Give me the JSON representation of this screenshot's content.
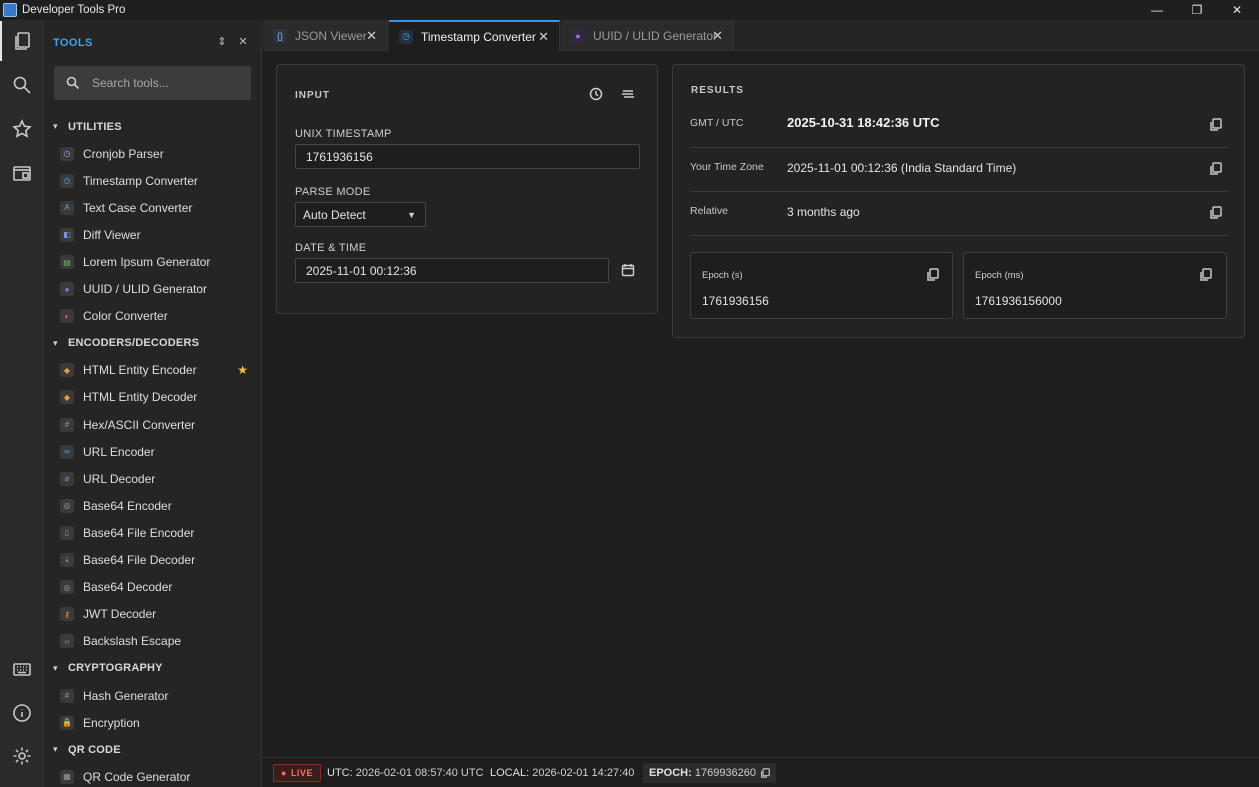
{
  "window": {
    "title": "Developer Tools Pro",
    "controls": [
      "—",
      "❐",
      "✕"
    ]
  },
  "activity": {
    "items": [
      "explorer",
      "search",
      "favorites",
      "window"
    ],
    "bottom": [
      "keyboard",
      "info",
      "settings"
    ]
  },
  "sidebar": {
    "header": "TOOLS",
    "search_placeholder": "Search tools...",
    "categories": [
      {
        "label": "UTILITIES",
        "tools": [
          {
            "label": "Cronjob Parser",
            "color": "#b48be0",
            "glyph": "◷"
          },
          {
            "label": "Timestamp Converter",
            "color": "#4aa3e0",
            "glyph": "◷"
          },
          {
            "label": "Text Case Converter",
            "color": "#6aa0d8",
            "glyph": "A"
          },
          {
            "label": "Diff Viewer",
            "color": "#7a9ae0",
            "glyph": "◧"
          },
          {
            "label": "Lorem Ipsum Generator",
            "color": "#5cb85c",
            "glyph": "▤"
          },
          {
            "label": "UUID / ULID Generator",
            "color": "#a070d0",
            "glyph": "●"
          },
          {
            "label": "Color Converter",
            "color": "#e06a8a",
            "glyph": "◐"
          }
        ]
      },
      {
        "label": "ENCODERS/DECODERS",
        "tools": [
          {
            "label": "HTML Entity Encoder",
            "color": "#e8a030",
            "glyph": "◆",
            "favorite": true
          },
          {
            "label": "HTML Entity Decoder",
            "color": "#e8a030",
            "glyph": "◆"
          },
          {
            "label": "Hex/ASCII Converter",
            "color": "#9a9a9a",
            "glyph": "#"
          },
          {
            "label": "URL Encoder",
            "color": "#4aa3e0",
            "glyph": "∞"
          },
          {
            "label": "URL Decoder",
            "color": "#4aa3e0",
            "glyph": "⌀"
          },
          {
            "label": "Base64 Encoder",
            "color": "#9a9a9a",
            "glyph": "◎"
          },
          {
            "label": "Base64 File Encoder",
            "color": "#9a9a9a",
            "glyph": "▯"
          },
          {
            "label": "Base64 File Decoder",
            "color": "#9a9a9a",
            "glyph": "⤓"
          },
          {
            "label": "Base64 Decoder",
            "color": "#9a9a9a",
            "glyph": "◎"
          },
          {
            "label": "JWT Decoder",
            "color": "#e8a030",
            "glyph": "⚷"
          },
          {
            "label": "Backslash Escape",
            "color": "#9a9a9a",
            "glyph": "‹›"
          }
        ]
      },
      {
        "label": "CRYPTOGRAPHY",
        "tools": [
          {
            "label": "Hash Generator",
            "color": "#9a9a9a",
            "glyph": "#"
          },
          {
            "label": "Encryption",
            "color": "#5cb85c",
            "glyph": "🔒"
          }
        ]
      },
      {
        "label": "QR CODE",
        "tools": [
          {
            "label": "QR Code Generator",
            "color": "#9a9a9a",
            "glyph": "▦"
          }
        ]
      }
    ]
  },
  "tabs": [
    {
      "label": "JSON Viewer",
      "icon": "braces-icon",
      "active": false
    },
    {
      "label": "Timestamp Converter",
      "icon": "clock-icon",
      "active": true
    },
    {
      "label": "UUID / ULID Generator",
      "icon": "uuid-icon",
      "active": false
    }
  ],
  "input": {
    "heading": "INPUT",
    "unix_label": "UNIX TIMESTAMP",
    "unix_value": "1761936156",
    "mode_label": "PARSE MODE",
    "mode_value": "Auto Detect",
    "datetime_label": "DATE & TIME",
    "datetime_value": "2025-11-01 00:12:36"
  },
  "results": {
    "heading": "RESULTS",
    "rows": [
      {
        "key": "GMT / UTC",
        "value": "2025-10-31 18:42:36 UTC"
      },
      {
        "key": "Your Time Zone",
        "value": "2025-11-01 00:12:36 (India Standard Time)"
      },
      {
        "key": "Relative",
        "value": "3 months ago"
      }
    ],
    "epoch_s_label": "Epoch (s)",
    "epoch_s_value": "1761936156",
    "epoch_ms_label": "Epoch (ms)",
    "epoch_ms_value": "1761936156000"
  },
  "status": {
    "live": "LIVE",
    "utc_label": "UTC:",
    "utc_value": "2026-02-01 08:57:40 UTC",
    "local_label": "LOCAL:",
    "local_value": "2026-02-01 14:27:40",
    "epoch_label": "EPOCH:",
    "epoch_value": "1769936260"
  }
}
